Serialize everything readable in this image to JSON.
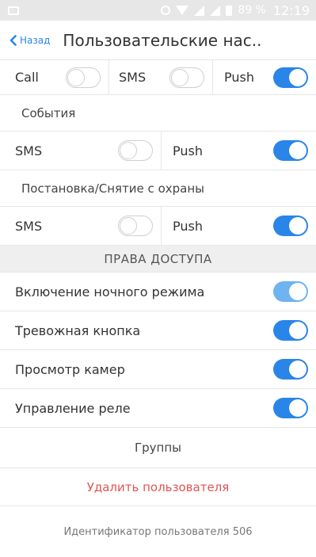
{
  "status_bar": {
    "battery_percent": "89 %",
    "time": "12:19"
  },
  "header": {
    "back_label": "Назад",
    "title": "Пользовательские нас.."
  },
  "top_row": [
    {
      "label": "Call",
      "on": false
    },
    {
      "label": "SMS",
      "on": false
    },
    {
      "label": "Push",
      "on": true
    }
  ],
  "events": {
    "label": "События",
    "sms": {
      "label": "SMS",
      "on": false
    },
    "push": {
      "label": "Push",
      "on": true
    }
  },
  "arming": {
    "label": "Постановка/Снятие с охраны",
    "sms": {
      "label": "SMS",
      "on": false
    },
    "push": {
      "label": "Push",
      "on": true
    }
  },
  "access_rights": {
    "header": "ПРАВА ДОСТУПА",
    "items": [
      {
        "label": "Включение ночного режима",
        "on": true
      },
      {
        "label": "Тревожная кнопка",
        "on": true
      },
      {
        "label": "Просмотр камер",
        "on": true
      },
      {
        "label": "Управление реле",
        "on": true
      }
    ]
  },
  "groups_label": "Группы",
  "delete_user_label": "Удалить пользователя",
  "user_id_label": "Идентификатор пользователя 506",
  "colors": {
    "accent": "#2a85e8",
    "accent_light": "#6fb3f0",
    "danger": "#e05555",
    "band": "#efefef"
  }
}
